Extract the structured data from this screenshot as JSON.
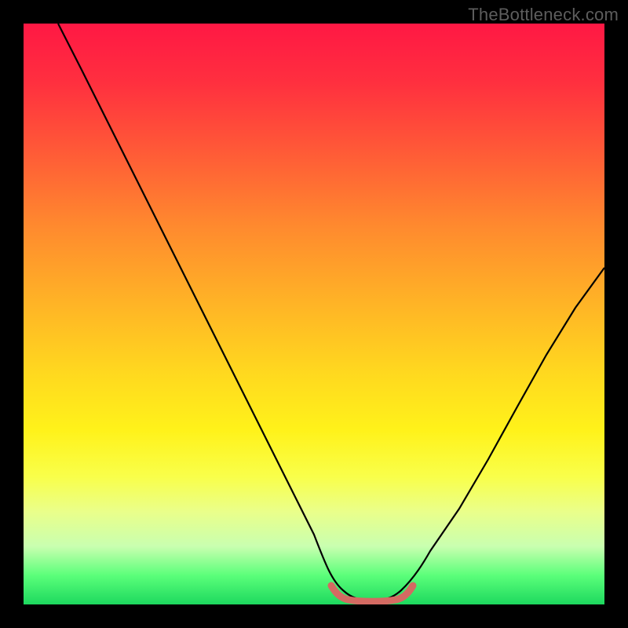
{
  "watermark": "TheBottleneck.com",
  "chart_data": {
    "type": "line",
    "title": "",
    "xlabel": "",
    "ylabel": "",
    "xlim": [
      0,
      100
    ],
    "ylim": [
      0,
      100
    ],
    "series": [
      {
        "name": "main-curve",
        "x": [
          6,
          10,
          15,
          20,
          25,
          30,
          35,
          40,
          45,
          50,
          53,
          55,
          58,
          60,
          63,
          65,
          70,
          75,
          80,
          85,
          90,
          95,
          100
        ],
        "values": [
          100,
          92,
          82,
          72,
          62,
          52,
          42,
          32,
          22,
          12,
          6,
          3,
          1,
          1,
          1,
          3,
          8,
          16,
          25,
          34,
          43,
          51,
          58
        ]
      },
      {
        "name": "bottom-accent",
        "x": [
          53,
          55,
          57,
          59,
          61,
          63,
          65
        ],
        "values": [
          3.0,
          1.5,
          1.0,
          1.0,
          1.0,
          1.5,
          3.0
        ]
      }
    ]
  },
  "colors": {
    "main_curve": "#000000",
    "accent": "#d46a62",
    "background_top": "#ff1844",
    "background_bottom": "#1dd85e"
  }
}
